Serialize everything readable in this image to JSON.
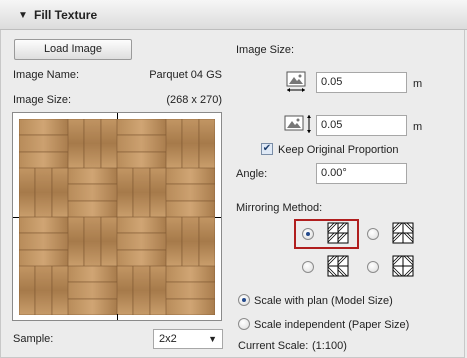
{
  "header": {
    "title": "Fill Texture"
  },
  "load_button": "Load Image",
  "image_name": {
    "label": "Image Name:",
    "value": "Parquet 04 GS"
  },
  "image_size_left": {
    "label": "Image Size:",
    "value": "(268 x 270)"
  },
  "image_size_right": {
    "label": "Image Size:"
  },
  "width_field": {
    "value": "0.05",
    "unit": "m"
  },
  "height_field": {
    "value": "0.05",
    "unit": "m"
  },
  "keep_proportion": {
    "label": "Keep Original Proportion",
    "checked": true
  },
  "angle": {
    "label": "Angle:",
    "value": "0.00°"
  },
  "mirroring": {
    "label": "Mirroring Method:",
    "selected_index": 0
  },
  "scale_options": [
    {
      "label": "Scale with plan (Model Size)",
      "selected": true
    },
    {
      "label": "Scale independent (Paper Size)",
      "selected": false
    }
  ],
  "current_scale": {
    "label": "Current Scale:",
    "value": "(1:100)"
  },
  "sample": {
    "label": "Sample:",
    "value": "2x2"
  },
  "colors": {
    "wood_light": "#c49a66",
    "wood_dark": "#9c7244",
    "highlight": "#b01e1e"
  }
}
